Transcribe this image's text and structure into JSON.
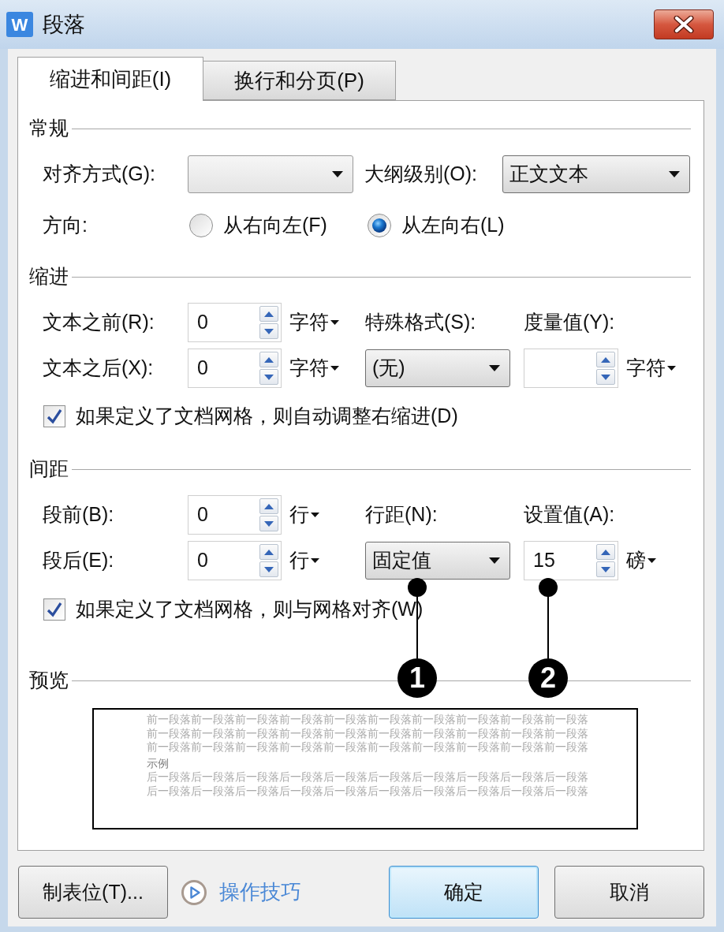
{
  "window": {
    "app_icon": "W",
    "title": "段落"
  },
  "tabs": [
    {
      "label": "缩进和间距(I)",
      "selected": true
    },
    {
      "label": "换行和分页(P)",
      "selected": false
    }
  ],
  "general": {
    "title": "常规",
    "alignment": {
      "label": "对齐方式(G):"
    },
    "outline_level": {
      "label": "大纲级别(O):",
      "value": "正文文本"
    },
    "direction": {
      "label": "方向:",
      "options": [
        {
          "label": "从右向左(F)",
          "selected": false
        },
        {
          "label": "从左向右(L)",
          "selected": true
        }
      ]
    }
  },
  "indent": {
    "title": "缩进",
    "before_text": {
      "label": "文本之前(R):",
      "value": "0",
      "unit": "字符"
    },
    "after_text": {
      "label": "文本之后(X):",
      "value": "0",
      "unit": "字符"
    },
    "special": {
      "label": "特殊格式(S):",
      "value": "(无)"
    },
    "measure": {
      "label": "度量值(Y):",
      "unit": "字符"
    },
    "auto_adjust": {
      "label": "如果定义了文档网格，则自动调整右缩进(D)",
      "checked": true
    }
  },
  "spacing": {
    "title": "间距",
    "before": {
      "label": "段前(B):",
      "value": "0",
      "unit": "行"
    },
    "after": {
      "label": "段后(E):",
      "value": "0",
      "unit": "行"
    },
    "line_spacing": {
      "label": "行距(N):",
      "value": "固定值"
    },
    "set_value": {
      "label": "设置值(A):",
      "value": "15",
      "unit": "磅"
    },
    "snap_to_grid": {
      "label": "如果定义了文档网格，则与网格对齐(W)",
      "checked": true
    }
  },
  "preview": {
    "title": "预览",
    "lines": [
      {
        "kind": "context",
        "text": "前一段落前一段落前一段落前一段落前一段落前一段落前一段落前一段落前一段落前一段落"
      },
      {
        "kind": "context",
        "text": "前一段落前一段落前一段落前一段落前一段落前一段落前一段落前一段落前一段落前一段落"
      },
      {
        "kind": "context",
        "text": "前一段落前一段落前一段落前一段落前一段落前一段落前一段落前一段落前一段落前一段落"
      },
      {
        "kind": "sample",
        "text": "示例"
      },
      {
        "kind": "context",
        "text": "后一段落后一段落后一段落后一段落后一段落后一段落后一段落后一段落后一段落后一段落"
      },
      {
        "kind": "context",
        "text": "后一段落后一段落后一段落后一段落后一段落后一段落后一段落后一段落后一段落后一段落"
      }
    ]
  },
  "callouts": [
    {
      "number": "1"
    },
    {
      "number": "2"
    }
  ],
  "footer": {
    "tabs_button": "制表位(T)...",
    "tips_link": "操作技巧",
    "buttons": [
      {
        "label": "确定",
        "default": true
      },
      {
        "label": "取消",
        "default": false
      }
    ]
  }
}
